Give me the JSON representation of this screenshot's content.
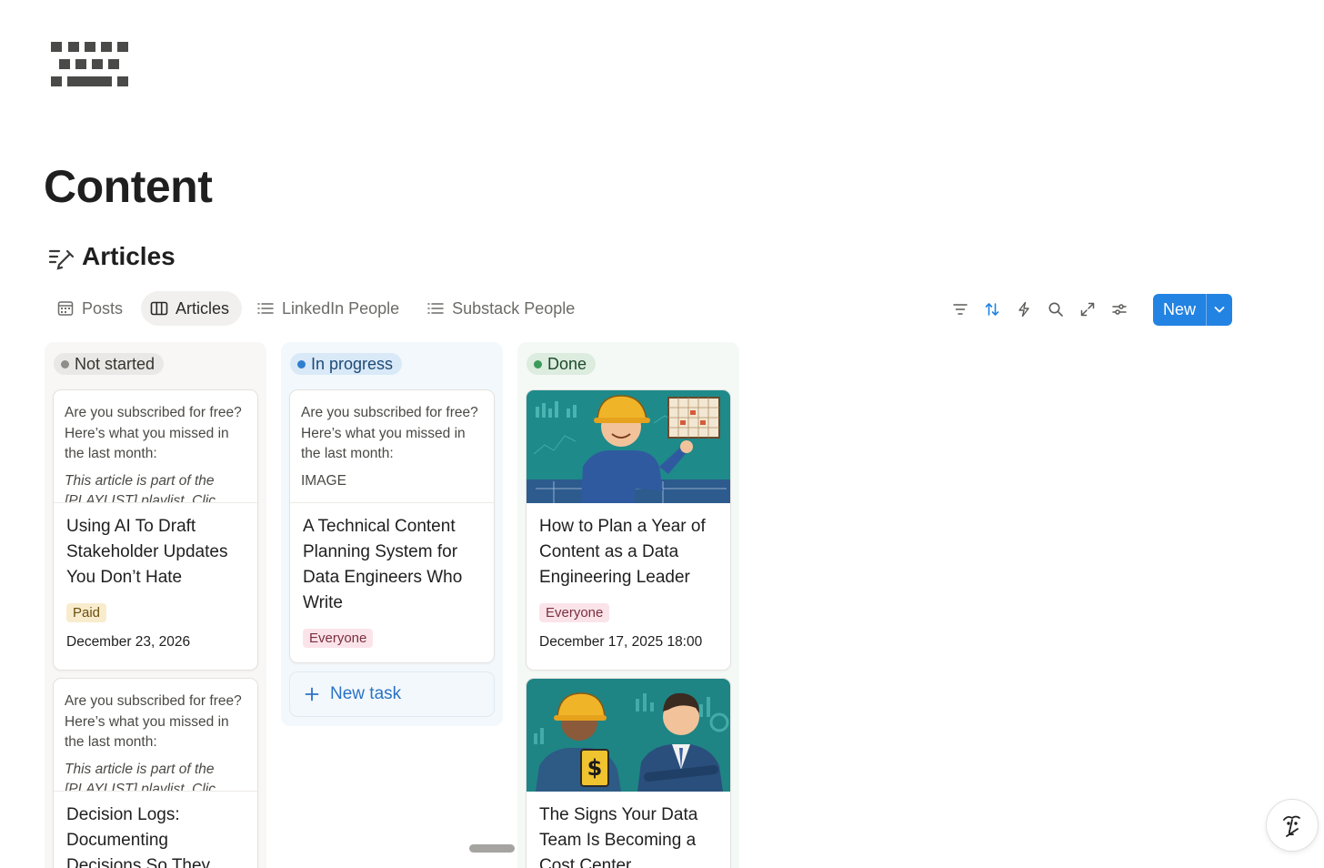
{
  "page": {
    "title": "Content"
  },
  "database": {
    "title": "Articles",
    "icon": "edit-lines-icon"
  },
  "tabs": [
    {
      "label": "Posts",
      "icon": "calendar-icon",
      "active": false
    },
    {
      "label": "Articles",
      "icon": "board-icon",
      "active": true
    },
    {
      "label": "LinkedIn People",
      "icon": "list-icon",
      "active": false
    },
    {
      "label": "Substack People",
      "icon": "list-icon",
      "active": false
    }
  ],
  "toolbar": {
    "icons": [
      "filter-icon",
      "sort-icon",
      "automation-icon",
      "search-icon",
      "expand-icon",
      "settings-icon"
    ],
    "new_label": "New"
  },
  "columns": [
    {
      "status": "Not started",
      "color": "#8e8d8a",
      "cards": [
        {
          "preview_text": "Are you subscribed for free? Here’s what you missed in the last month:",
          "preview_extra": "This article is part of the [PLAYLIST] playlist. Clic",
          "title": "Using AI To Draft Stakeholder Updates You Don’t Hate",
          "tag": "Paid",
          "date": "December 23, 2026"
        },
        {
          "preview_text": "Are you subscribed for free? Here’s what you missed in the last month:",
          "preview_extra": "This article is part of the [PLAYLIST] playlist. Clic",
          "title": "Decision Logs: Documenting Decisions So They"
        }
      ]
    },
    {
      "status": "In progress",
      "color": "#2f7fd0",
      "cards": [
        {
          "preview_text": "Are you subscribed for free? Here’s what you missed in the last month:",
          "preview_extra": "IMAGE",
          "title": "A Technical Content Planning System for Data Engineers Who Write",
          "tag": "Everyone"
        }
      ],
      "new_task_label": "New task"
    },
    {
      "status": "Done",
      "color": "#3a9a5a",
      "cards": [
        {
          "title": "How to Plan a Year of Content as a Data Engineering Leader",
          "tag": "Everyone",
          "date": "December 17, 2025 18:00"
        },
        {
          "title": "The Signs Your Data Team Is Becoming a Cost Center"
        }
      ]
    }
  ]
}
